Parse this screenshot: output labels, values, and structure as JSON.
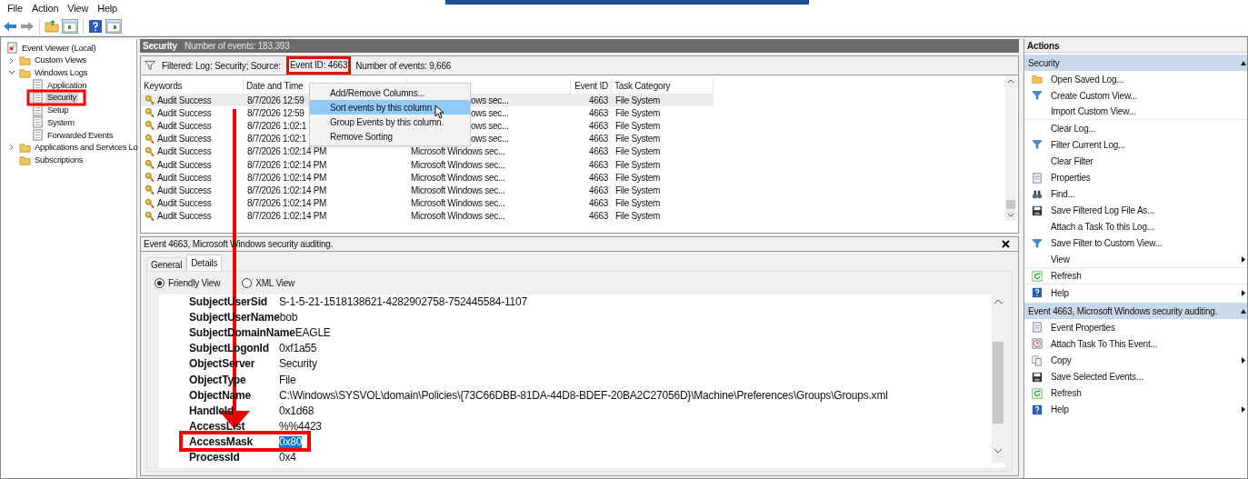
{
  "menu_bar": [
    "File",
    "Action",
    "View",
    "Help"
  ],
  "tree": [
    {
      "label": "Event Viewer (Local)",
      "kind": "viewer",
      "selected": false,
      "children": [
        {
          "label": "Custom Views",
          "kind": "folder",
          "expanded": false,
          "selected": false
        },
        {
          "label": "Windows Logs",
          "kind": "folder",
          "expanded": true,
          "selected": false,
          "children": [
            {
              "label": "Application",
              "kind": "log",
              "selected": false
            },
            {
              "label": "Security",
              "kind": "log",
              "selected": true
            },
            {
              "label": "Setup",
              "kind": "log",
              "selected": false
            },
            {
              "label": "System",
              "kind": "log",
              "selected": false
            },
            {
              "label": "Forwarded Events",
              "kind": "log",
              "selected": false
            }
          ]
        },
        {
          "label": "Applications and Services Lo",
          "kind": "folder",
          "expanded": false,
          "selected": false
        },
        {
          "label": "Subscriptions",
          "kind": "folder",
          "selected": false
        }
      ]
    }
  ],
  "log_header": {
    "title": "Security",
    "count": "Number of events: 183,393"
  },
  "filter_bar": {
    "text": "Filtered: Log: Security; Source:",
    "event_id": "Event ID: 4663",
    "count": "Number of events: 9,666"
  },
  "table": {
    "columns": [
      {
        "label": "Keywords"
      },
      {
        "label": "Date and Time"
      },
      {},
      {
        "label": "Event ID"
      },
      {
        "label": "Task Category"
      }
    ],
    "rows": [
      {
        "keywords": "Audit Success",
        "date": "8/7/2026 12:59",
        "source": "ows sec...",
        "event_id": "4663",
        "task_category": "File System",
        "selected": true
      },
      {
        "keywords": "Audit Success",
        "date": "8/7/2026 12:59",
        "source": "ows sec...",
        "event_id": "4663",
        "task_category": "File System",
        "selected": false
      },
      {
        "keywords": "Audit Success",
        "date": "8/7/2026 1:02:1",
        "source": "ows sec...",
        "event_id": "4663",
        "task_category": "File System",
        "selected": false
      },
      {
        "keywords": "Audit Success",
        "date": "8/7/2026 1:02:1",
        "source": "ows sec...",
        "event_id": "4663",
        "task_category": "File System",
        "selected": false
      },
      {
        "keywords": "Audit Success",
        "date": "8/7/2026 1:02:14 PM",
        "source": "Microsoft Windows sec...",
        "event_id": "4663",
        "task_category": "File System",
        "selected": false
      },
      {
        "keywords": "Audit Success",
        "date": "8/7/2026 1:02:14 PM",
        "source": "Microsoft Windows sec...",
        "event_id": "4663",
        "task_category": "File System",
        "selected": false
      },
      {
        "keywords": "Audit Success",
        "date": "8/7/2026 1:02:14 PM",
        "source": "Microsoft Windows sec...",
        "event_id": "4663",
        "task_category": "File System",
        "selected": false
      },
      {
        "keywords": "Audit Success",
        "date": "8/7/2026 1:02:14 PM",
        "source": "Microsoft Windows sec...",
        "event_id": "4663",
        "task_category": "File System",
        "selected": false
      },
      {
        "keywords": "Audit Success",
        "date": "8/7/2026 1:02:14 PM",
        "source": "Microsoft Windows sec...",
        "event_id": "4663",
        "task_category": "File System",
        "selected": false
      },
      {
        "keywords": "Audit Success",
        "date": "8/7/2026 1:02:14 PM",
        "source": "Microsoft Windows sec...",
        "event_id": "4663",
        "task_category": "File System",
        "selected": false
      }
    ]
  },
  "context_menu": [
    {
      "label": "Add/Remove Columns...",
      "selected": false
    },
    {
      "label": "Sort events by this column",
      "selected": true
    },
    {
      "label": "Group Events by this column.",
      "selected": false
    },
    {
      "label": "Remove Sorting",
      "selected": false
    }
  ],
  "detail": {
    "title": "Event 4663, Microsoft Windows security auditing.",
    "tabs": [
      {
        "label": "General",
        "selected": false
      },
      {
        "label": "Details",
        "selected": true
      }
    ],
    "views": [
      {
        "label": "Friendly View",
        "selected": true
      },
      {
        "label": "XML View",
        "selected": false
      }
    ],
    "fields": [
      {
        "name": "SubjectUserSid",
        "value": "S-1-5-21-1518138621-4282902758-752445584-1107",
        "selected": false
      },
      {
        "name": "SubjectUserName",
        "value": "bob",
        "selected": false
      },
      {
        "name": "SubjectDomainName",
        "value": "EAGLE",
        "selected": false
      },
      {
        "name": "SubjectLogonId",
        "value": "0xf1a55",
        "selected": false
      },
      {
        "name": "ObjectServer",
        "value": "Security",
        "selected": false
      },
      {
        "name": "ObjectType",
        "value": "File",
        "selected": false
      },
      {
        "name": "ObjectName",
        "value": "C:\\Windows\\SYSVOL\\domain\\Policies\\{73C66DBB-81DA-44D8-BDEF-20BA2C27056D}\\Machine\\Preferences\\Groups\\Groups.xml",
        "selected": false
      },
      {
        "name": "HandleId",
        "value": "0x1d68",
        "selected": false
      },
      {
        "name": "AccessList",
        "value": "%%4423",
        "selected": false
      },
      {
        "name": "AccessMask",
        "value": "0x80",
        "selected": true
      },
      {
        "name": "ProcessId",
        "value": "0x4",
        "selected": false
      }
    ]
  },
  "actions": {
    "title": "Actions",
    "sections": [
      {
        "title": "Security",
        "items": [
          {
            "label": "Open Saved Log...",
            "kind": "folder"
          },
          {
            "label": "Create Custom View...",
            "kind": "filter"
          },
          {
            "label": "Import Custom View...",
            "divider_after": true
          },
          {
            "label": "Clear Log..."
          },
          {
            "label": "Filter Current Log...",
            "kind": "filter"
          },
          {
            "label": "Clear Filter"
          },
          {
            "label": "Properties",
            "kind": "props"
          },
          {
            "label": "Find...",
            "kind": "find"
          },
          {
            "label": "Save Filtered Log File As...",
            "kind": "save"
          },
          {
            "label": "Attach a Task To this Log..."
          },
          {
            "label": "Save Filter to Custom View...",
            "kind": "filter"
          },
          {
            "label": "View",
            "submenu": true,
            "divider_after": true
          },
          {
            "label": "Refresh",
            "kind": "refresh",
            "divider_after": true
          },
          {
            "label": "Help",
            "kind": "help",
            "submenu": true
          }
        ]
      },
      {
        "title": "Event 4663, Microsoft Windows security auditing.",
        "items": [
          {
            "label": "Event Properties",
            "kind": "props"
          },
          {
            "label": "Attach Task To This Event...",
            "kind": "task"
          },
          {
            "label": "Copy",
            "kind": "copy",
            "submenu": true
          },
          {
            "label": "Save Selected Events...",
            "kind": "save"
          },
          {
            "label": "Refresh",
            "kind": "refresh"
          },
          {
            "label": "Help",
            "kind": "help",
            "submenu": true
          }
        ]
      }
    ]
  }
}
